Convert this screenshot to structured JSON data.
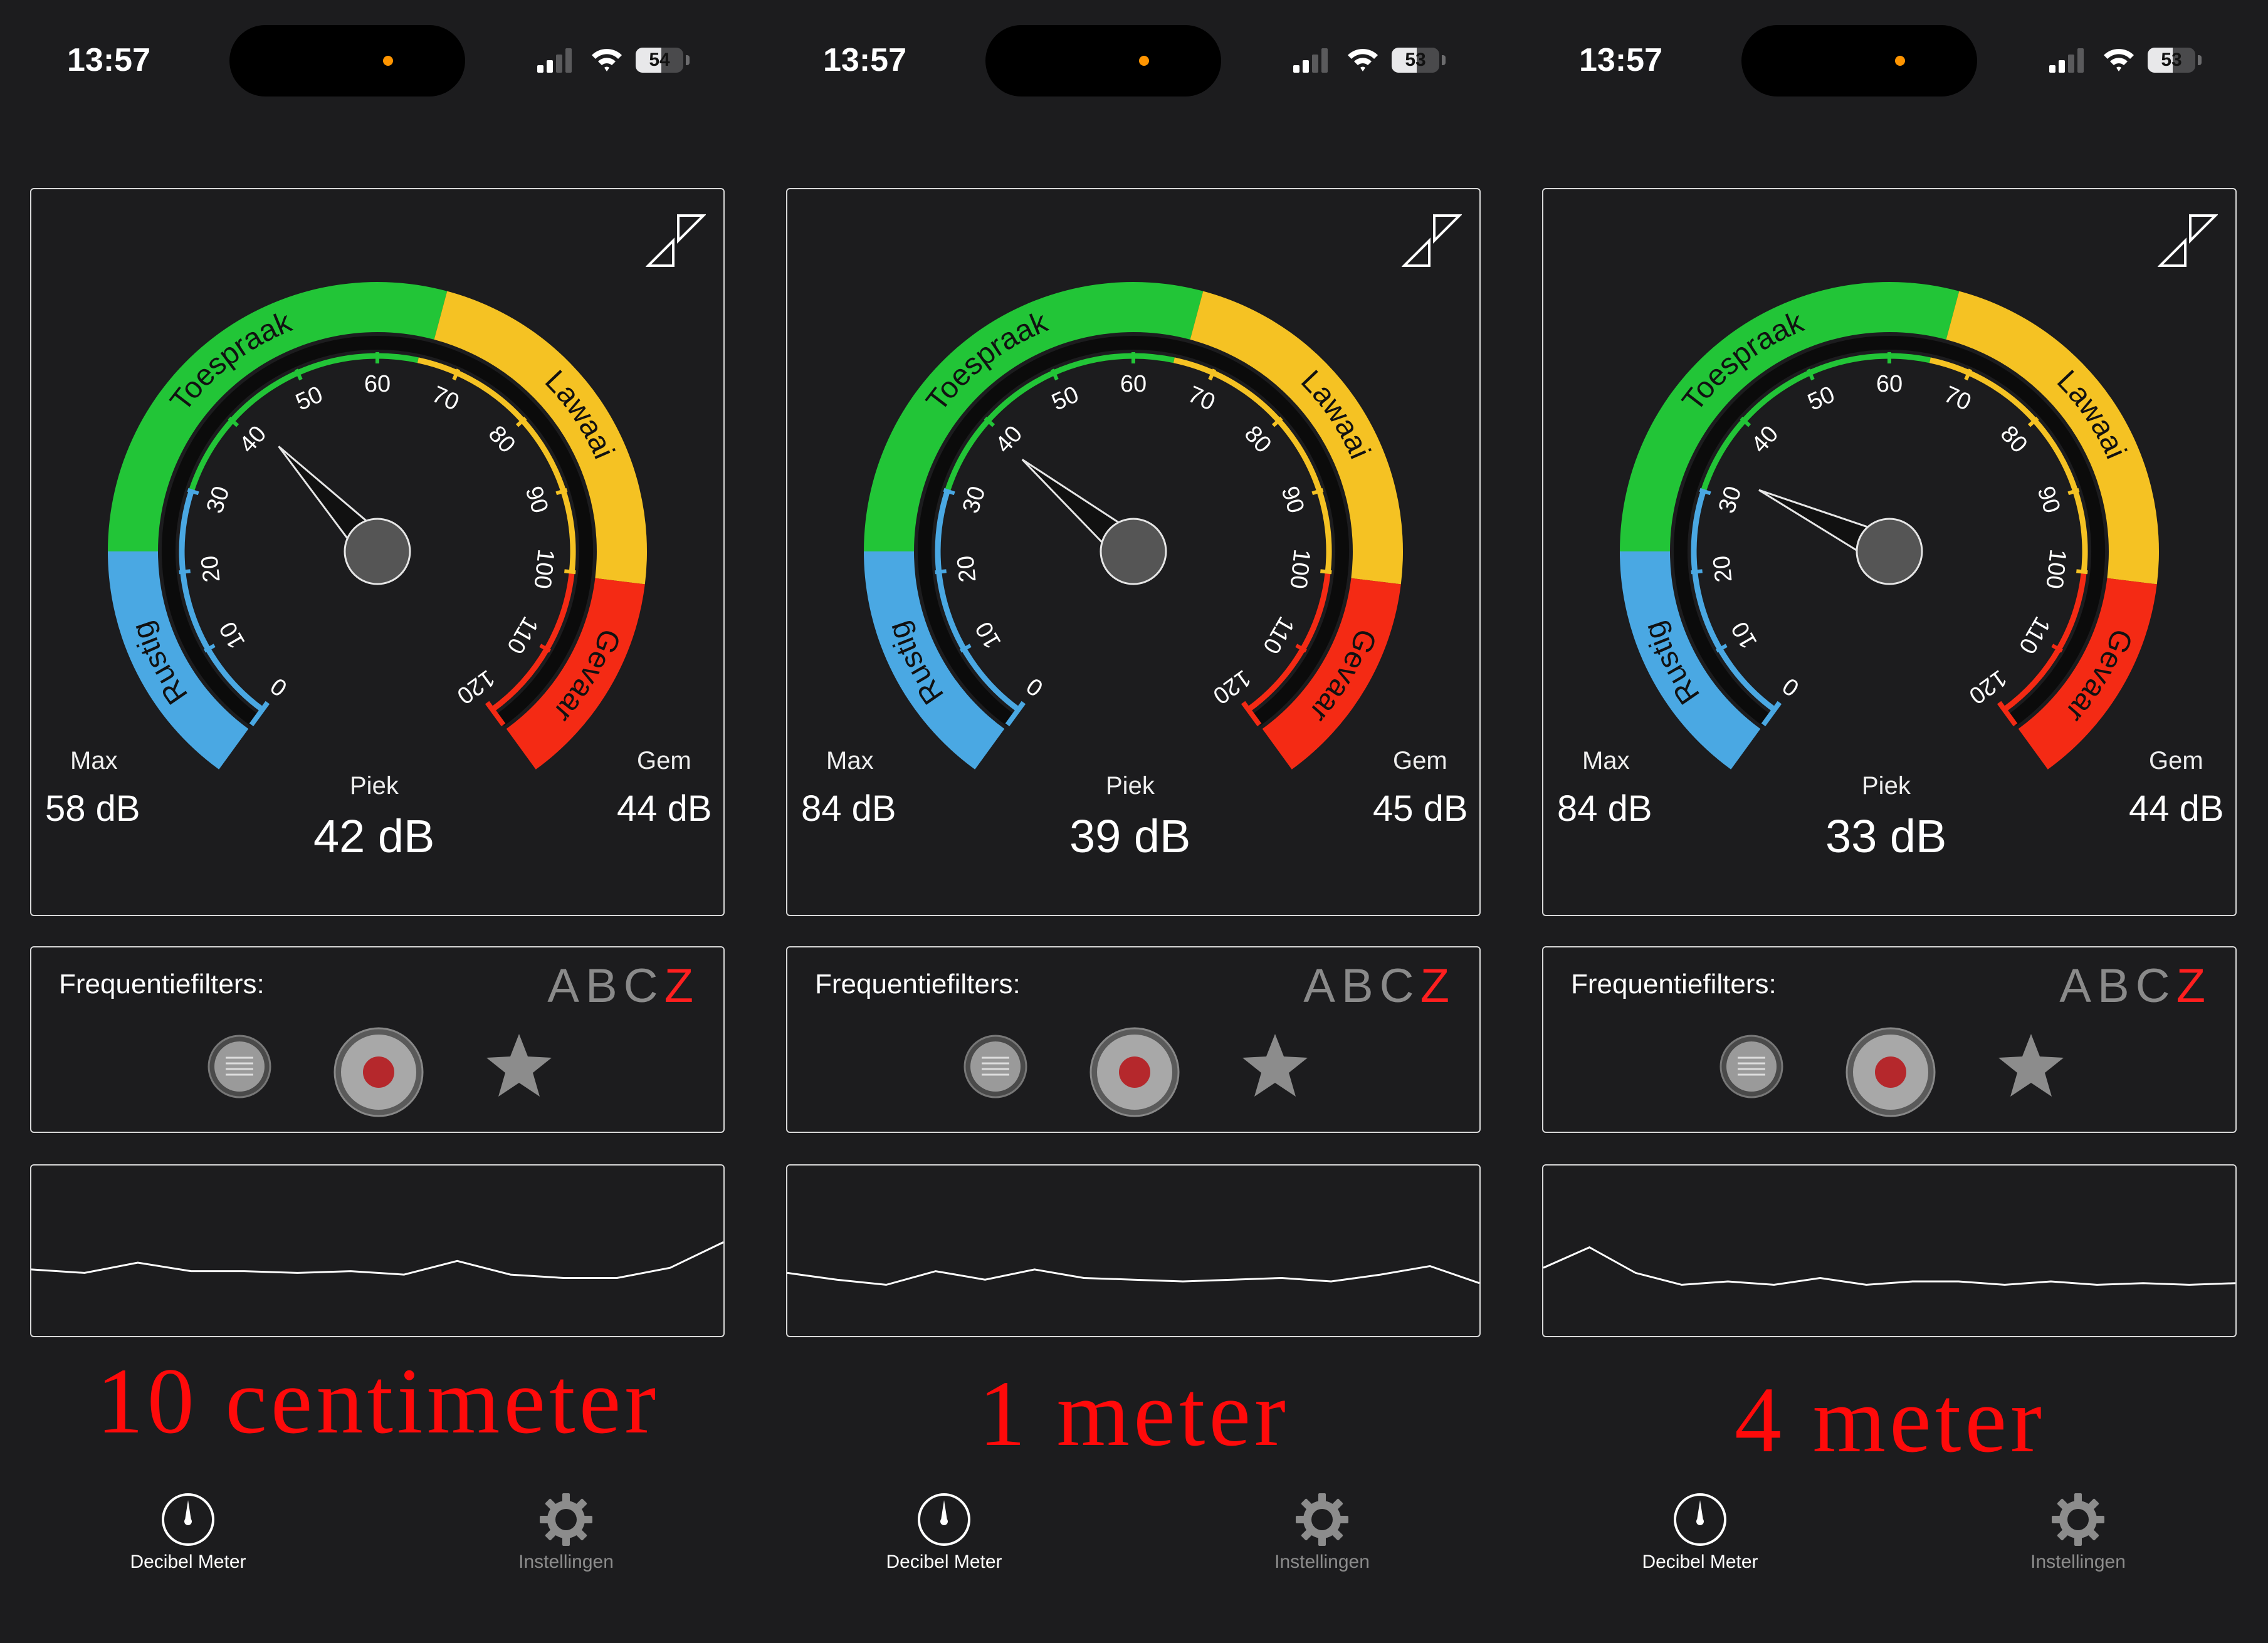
{
  "gauge_scale": {
    "ticks": [
      "0",
      "10",
      "20",
      "30",
      "40",
      "50",
      "60",
      "70",
      "80",
      "90",
      "100",
      "110",
      "120"
    ],
    "bands": [
      "Rustig",
      "Toespraak",
      "Lawaai",
      "Gevaar"
    ],
    "band_colors": {
      "Rustig": "#4aa8e3",
      "Toespraak": "#22c537",
      "Lawaai": "#f5c223",
      "Gevaar": "#f42a14"
    }
  },
  "phones": [
    {
      "status": {
        "time": "13:57",
        "battery": "54"
      },
      "meter": {
        "needle_db": 42,
        "max_label": "Max",
        "max_value": "58 dB",
        "piek_label": "Piek",
        "piek_value": "42 dB",
        "gem_label": "Gem",
        "gem_value": "44 dB"
      },
      "filters": {
        "label": "Frequentiefilters:",
        "letters": [
          "A",
          "B",
          "C",
          "Z"
        ],
        "active": "Z"
      },
      "graph": [
        0.61,
        0.63,
        0.57,
        0.62,
        0.62,
        0.63,
        0.62,
        0.64,
        0.56,
        0.64,
        0.66,
        0.66,
        0.6,
        0.45
      ],
      "caption": "10 centimeter",
      "tabs": [
        {
          "label": "Decibel Meter",
          "active": true
        },
        {
          "label": "Instellingen",
          "active": false
        }
      ]
    },
    {
      "status": {
        "time": "13:57",
        "battery": "53"
      },
      "meter": {
        "needle_db": 39,
        "max_label": "Max",
        "max_value": "84 dB",
        "piek_label": "Piek",
        "piek_value": "39 dB",
        "gem_label": "Gem",
        "gem_value": "45 dB"
      },
      "filters": {
        "label": "Frequentiefilters:",
        "letters": [
          "A",
          "B",
          "C",
          "Z"
        ],
        "active": "Z"
      },
      "graph": [
        0.63,
        0.67,
        0.7,
        0.62,
        0.67,
        0.61,
        0.66,
        0.67,
        0.68,
        0.67,
        0.66,
        0.68,
        0.64,
        0.59,
        0.69
      ],
      "caption": "1 meter",
      "tabs": [
        {
          "label": "Decibel Meter",
          "active": true
        },
        {
          "label": "Instellingen",
          "active": false
        }
      ]
    },
    {
      "status": {
        "time": "13:57",
        "battery": "53"
      },
      "meter": {
        "needle_db": 33,
        "max_label": "Max",
        "max_value": "84 dB",
        "piek_label": "Piek",
        "piek_value": "33 dB",
        "gem_label": "Gem",
        "gem_value": "44 dB"
      },
      "filters": {
        "label": "Frequentiefilters:",
        "letters": [
          "A",
          "B",
          "C",
          "Z"
        ],
        "active": "Z"
      },
      "graph": [
        0.6,
        0.48,
        0.63,
        0.7,
        0.68,
        0.7,
        0.66,
        0.7,
        0.68,
        0.68,
        0.7,
        0.68,
        0.7,
        0.69,
        0.7,
        0.69
      ],
      "caption": "4 meter",
      "tabs": [
        {
          "label": "Decibel Meter",
          "active": true
        },
        {
          "label": "Instellingen",
          "active": false
        }
      ]
    }
  ]
}
